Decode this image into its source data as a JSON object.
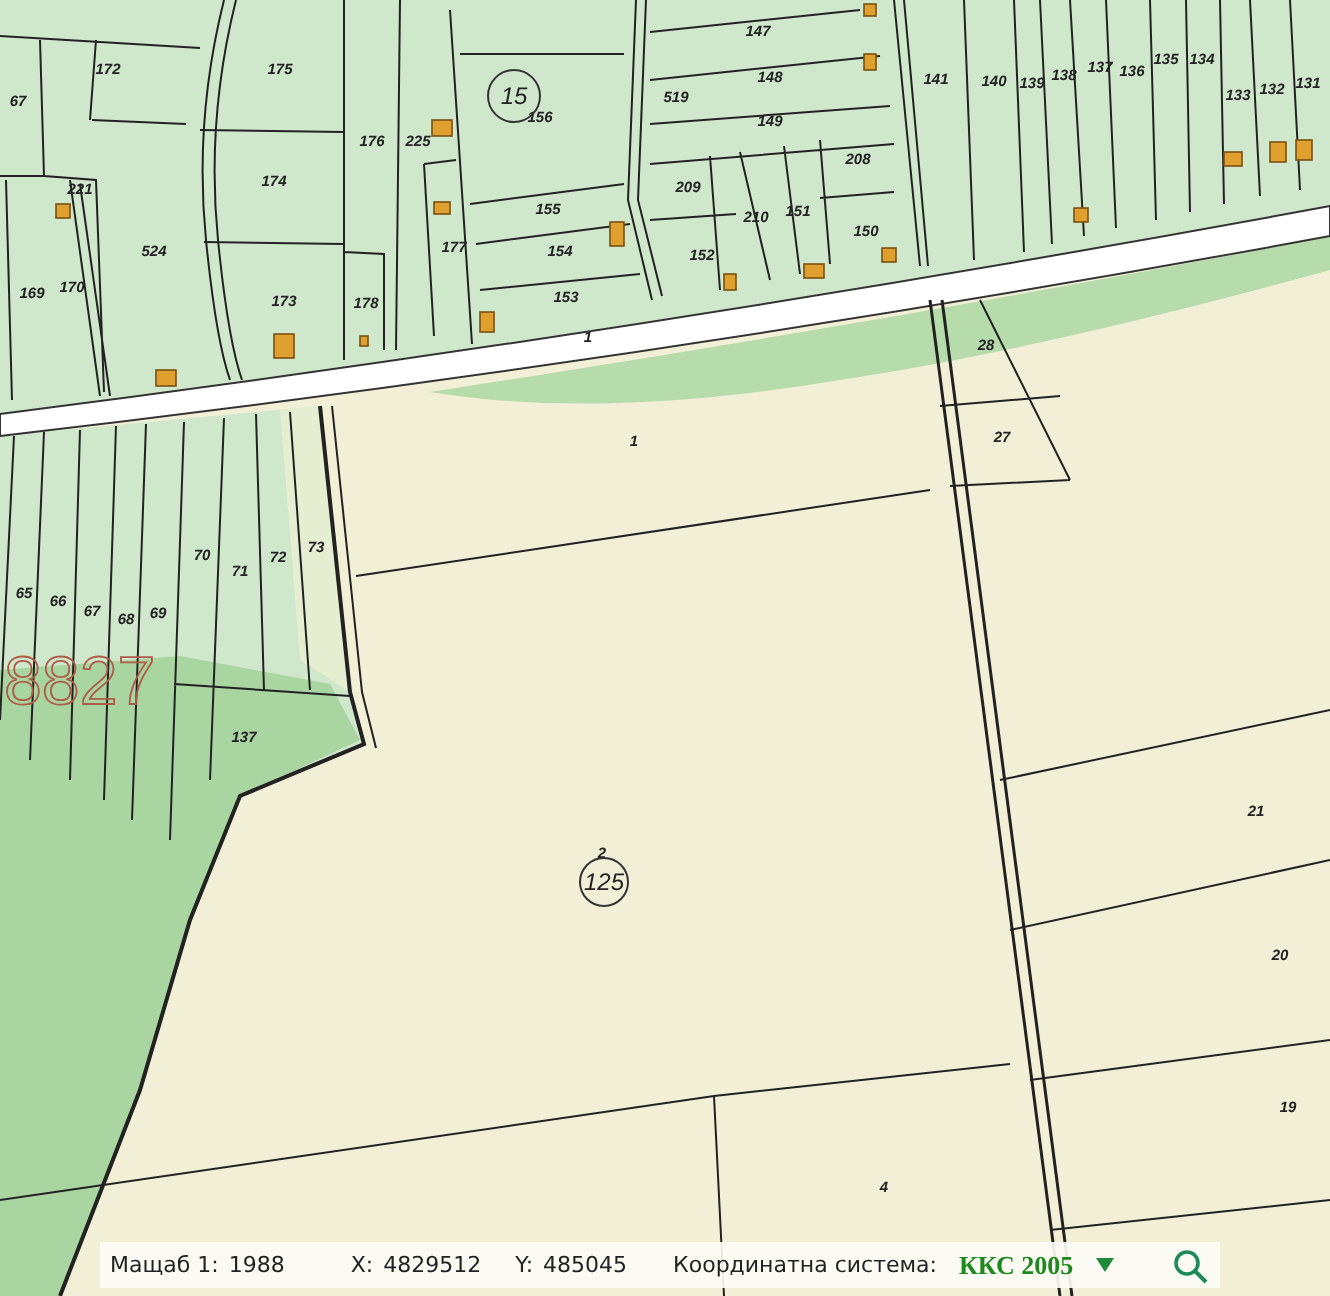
{
  "map": {
    "parcel_numbers": [
      "67",
      "172",
      "175",
      "176",
      "225",
      "156",
      "519",
      "147",
      "148",
      "149",
      "141",
      "140",
      "139",
      "138",
      "137",
      "136",
      "135",
      "134",
      "133",
      "132",
      "131",
      "174",
      "221",
      "155",
      "524",
      "154",
      "209",
      "210",
      "151",
      "208",
      "150",
      "152",
      "177",
      "169",
      "170",
      "173",
      "178",
      "153",
      "1",
      "28",
      "1",
      "27",
      "70",
      "71",
      "72",
      "73",
      "65",
      "66",
      "67",
      "68",
      "69",
      "137",
      "21",
      "2",
      "20",
      "19",
      "4"
    ],
    "block_numbers": [
      "15",
      "125"
    ],
    "land_area_number": "8827"
  },
  "status_bar": {
    "scale_label": "Мащаб 1:",
    "scale_value": "1988",
    "x_label": "X:",
    "x_value": "4829512",
    "y_label": "Y:",
    "y_value": "485045",
    "crs_label": "Координатна система:",
    "crs_value": "ККС 2005"
  }
}
